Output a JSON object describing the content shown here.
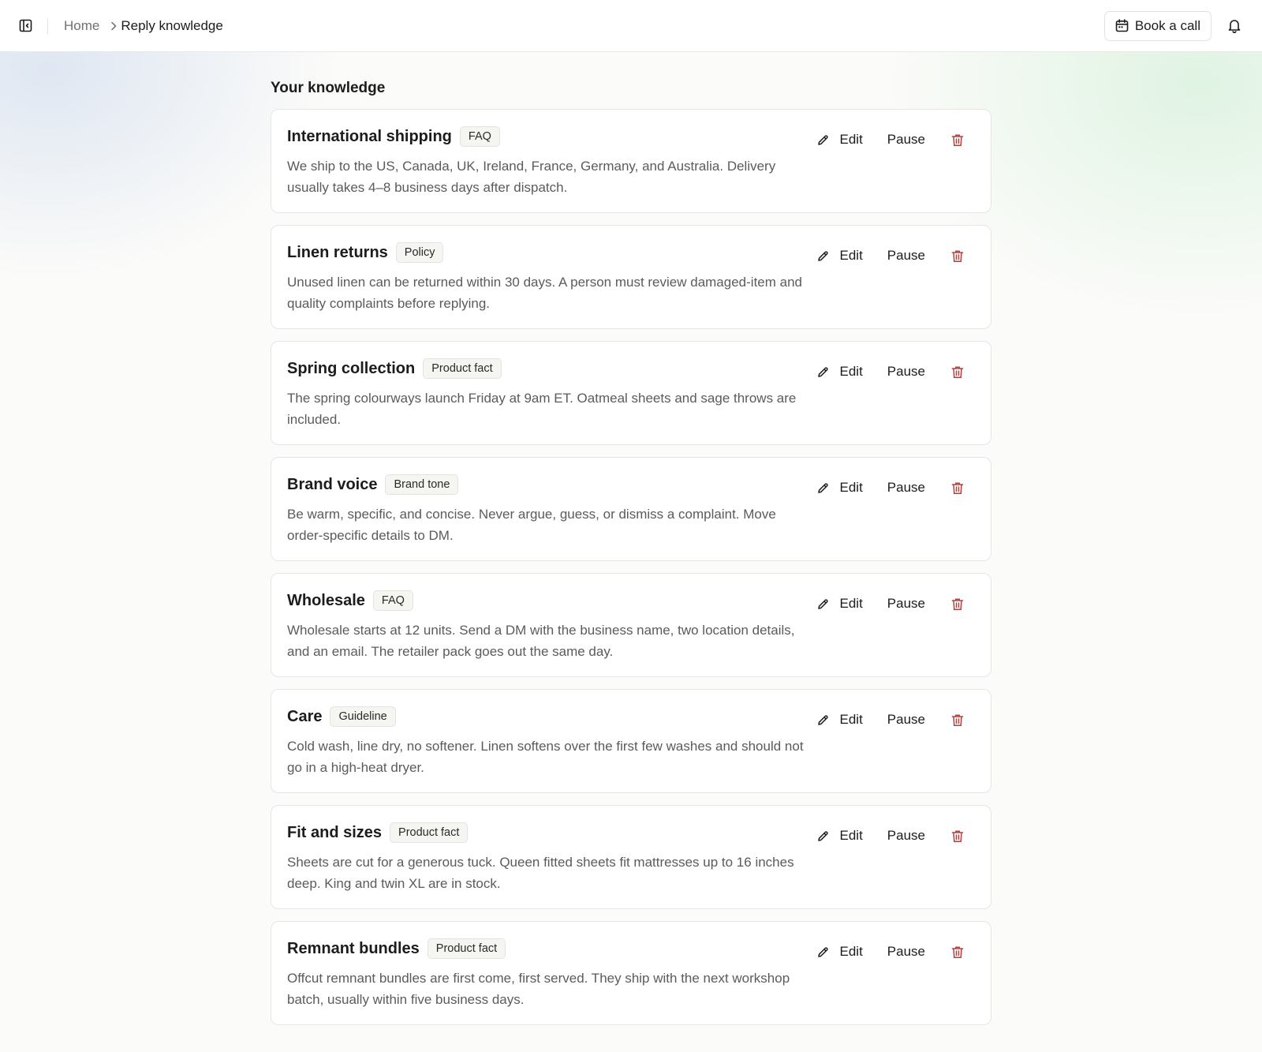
{
  "colors": {
    "accent_delete": "#b0413e",
    "text_primary": "#1c1c1c",
    "text_muted": "#5b5b5b"
  },
  "header": {
    "sidebar_toggle_icon": "sidebar-panel-icon",
    "breadcrumb": {
      "home": "Home",
      "current": "Reply knowledge"
    },
    "book_call": {
      "label": "Book a call",
      "icon": "calendar-icon"
    },
    "notifications_icon": "bell-icon"
  },
  "main": {
    "title": "Your knowledge",
    "actions": {
      "edit": "Edit",
      "pause": "Pause"
    },
    "items": [
      {
        "title": "International shipping",
        "tag": "FAQ",
        "body": "We ship to the US, Canada, UK, Ireland, France, Germany, and Australia. Delivery usually takes 4–8 business days after dispatch."
      },
      {
        "title": "Linen returns",
        "tag": "Policy",
        "body": "Unused linen can be returned within 30 days. A person must review damaged-item and quality complaints before replying."
      },
      {
        "title": "Spring collection",
        "tag": "Product fact",
        "body": "The spring colourways launch Friday at 9am ET. Oatmeal sheets and sage throws are included."
      },
      {
        "title": "Brand voice",
        "tag": "Brand tone",
        "body": "Be warm, specific, and concise. Never argue, guess, or dismiss a complaint. Move order-specific details to DM."
      },
      {
        "title": "Wholesale",
        "tag": "FAQ",
        "body": "Wholesale starts at 12 units. Send a DM with the business name, two location details, and an email. The retailer pack goes out the same day."
      },
      {
        "title": "Care",
        "tag": "Guideline",
        "body": "Cold wash, line dry, no softener. Linen softens over the first few washes and should not go in a high-heat dryer."
      },
      {
        "title": "Fit and sizes",
        "tag": "Product fact",
        "body": "Sheets are cut for a generous tuck. Queen fitted sheets fit mattresses up to 16 inches deep. King and twin XL are in stock."
      },
      {
        "title": "Remnant bundles",
        "tag": "Product fact",
        "body": "Offcut remnant bundles are first come, first served. They ship with the next workshop batch, usually within five business days."
      }
    ]
  }
}
